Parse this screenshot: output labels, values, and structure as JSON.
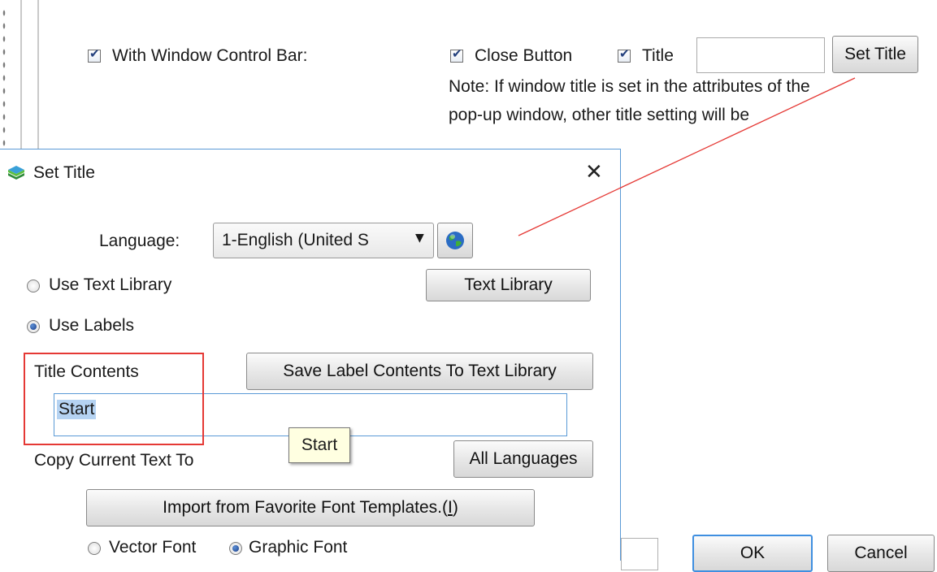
{
  "background_panel": {
    "with_window_control_bar": {
      "label": "With Window Control Bar:",
      "checked": true
    },
    "close_button": {
      "label": "Close Button",
      "checked": true
    },
    "title_option": {
      "label": "Title",
      "checked": true
    },
    "title_value": "",
    "set_title_button": "Set Title",
    "note_line1": "Note: If window title is set in the attributes of the",
    "note_line2": "pop-up window, other title setting will be"
  },
  "dialog": {
    "title": "Set Title",
    "close_glyph": "✕",
    "language_label": "Language:",
    "language_value": "1-English (United S",
    "use_text_library": {
      "label": "Use Text Library",
      "selected": false
    },
    "text_library_button": "Text Library",
    "use_labels": {
      "label": "Use Labels",
      "selected": true
    },
    "title_contents_label": "Title Contents",
    "save_label_button": "Save Label Contents To Text Library",
    "title_input_value": "Start",
    "tooltip": "Start",
    "copy_current_text_label": "Copy Current Text To",
    "all_languages_button": "All Languages",
    "import_button_prefix": "Import from Favorite Font Templates.(",
    "import_button_key": "I",
    "import_button_suffix": ")",
    "vector_font": {
      "label": "Vector Font",
      "selected": false
    },
    "graphic_font": {
      "label": "Graphic Font",
      "selected": true
    }
  },
  "bottom_buttons": {
    "ok": "OK",
    "cancel": "Cancel"
  },
  "colors": {
    "accent": "#3f8fe0",
    "annotation": "#e53935",
    "tooltip_bg": "#ffffe1"
  },
  "icons": [
    "app-icon",
    "globe-icon",
    "check-icon",
    "close-icon",
    "dropdown-arrow-icon"
  ]
}
